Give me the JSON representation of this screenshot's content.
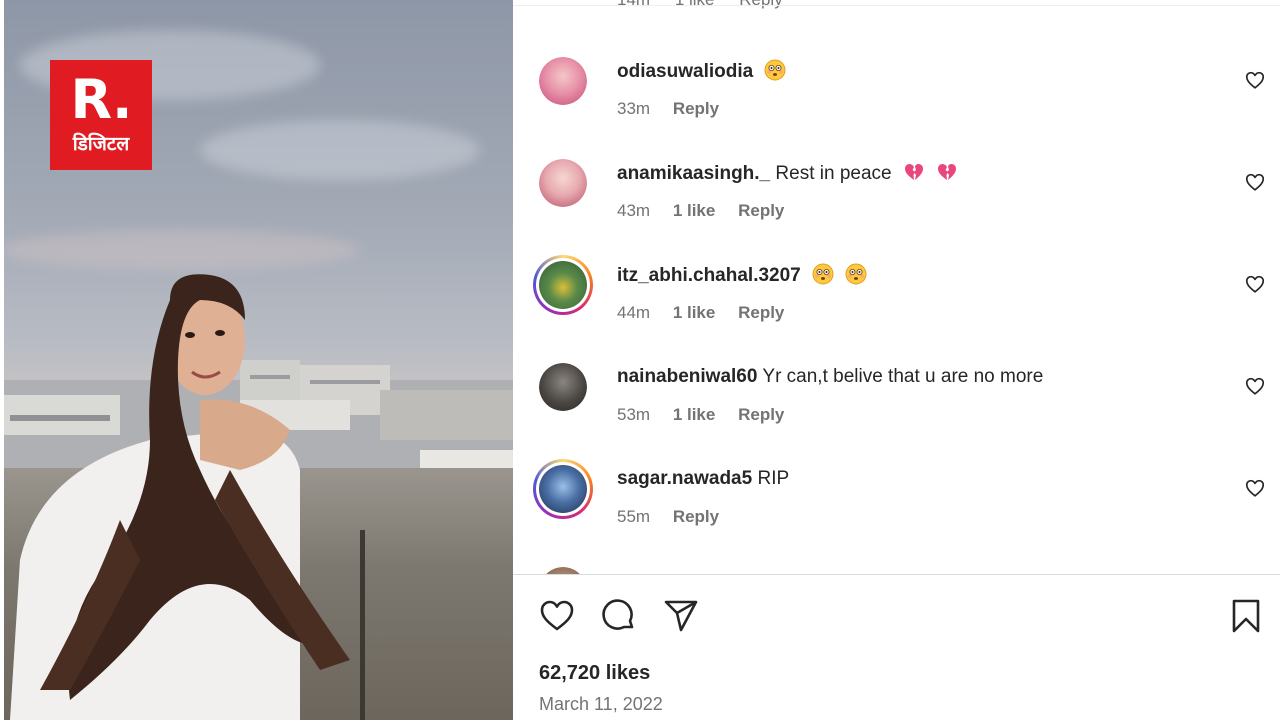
{
  "brand": {
    "logo_text": "R.",
    "logo_subtext": "डिजिटल",
    "logo_color": "#e11b22"
  },
  "previous_comment_meta": {
    "time": "14m",
    "likes": "1 like",
    "reply": "Reply"
  },
  "comments": [
    {
      "username": "odiasuwaliodia",
      "text": "",
      "emojis": [
        "flushed-face"
      ],
      "time": "33m",
      "likes": "",
      "reply": "Reply",
      "story_ring": false
    },
    {
      "username": "anamikaasingh._",
      "text": "Rest in peace",
      "emojis": [
        "broken-heart",
        "broken-heart"
      ],
      "time": "43m",
      "likes": "1 like",
      "reply": "Reply",
      "story_ring": false
    },
    {
      "username": "itz_abhi.chahal.3207",
      "text": "",
      "emojis": [
        "flushed-face",
        "flushed-face"
      ],
      "time": "44m",
      "likes": "1 like",
      "reply": "Reply",
      "story_ring": true
    },
    {
      "username": "nainabeniwal60",
      "text": "Yr can,t belive that u are no more",
      "emojis": [],
      "time": "53m",
      "likes": "1 like",
      "reply": "Reply",
      "story_ring": false
    },
    {
      "username": "sagar.nawada5",
      "text": "RIP",
      "emojis": [],
      "time": "55m",
      "likes": "",
      "reply": "Reply",
      "story_ring": true
    }
  ],
  "post": {
    "likes_label": "62,720 likes",
    "date": "March 11, 2022"
  },
  "icons": {
    "like": "heart-icon",
    "comment": "comment-bubble-icon",
    "share": "paper-plane-icon",
    "save": "bookmark-icon",
    "comment_like": "heart-icon"
  }
}
